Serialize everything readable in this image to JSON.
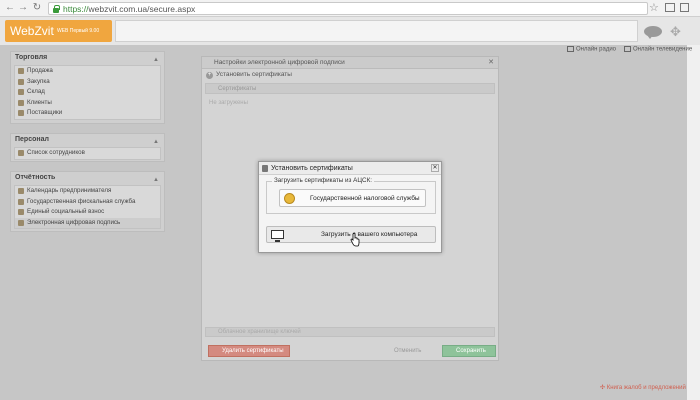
{
  "browser": {
    "url_protocol": "https://",
    "url_host": "webzvit.com.ua",
    "url_path": "/secure.aspx"
  },
  "header": {
    "logo": "WebZvit",
    "logo_subtitle": "WEB Первый 9.00"
  },
  "top_links": {
    "radio": "Онлайн радио",
    "tv": "Онлайн телевидение"
  },
  "sidebar": {
    "sections": [
      {
        "title": "Торговля",
        "items": [
          "Продажа",
          "Закупка",
          "Склад",
          "Клиенты",
          "Поставщики"
        ]
      },
      {
        "title": "Персонал",
        "items": [
          "Список сотрудников"
        ]
      },
      {
        "title": "Отчётность",
        "items": [
          "Календарь предпринимателя",
          "Государственная фискальная служба",
          "Единый социальный взнос",
          "Электронная цифровая подпись"
        ]
      }
    ]
  },
  "settings_dialog": {
    "title": "Настройки электронной цифровой подписи",
    "install_label": "Установить сертификаты",
    "certificates_tab": "Сертификаты",
    "empty_text": "Не загружены",
    "storage_tab": "Облачное хранилище ключей",
    "delete_button": "Удалить сертификаты",
    "cancel_button": "Отменить",
    "save_button": "Сохранить"
  },
  "modal": {
    "title": "Установить сертификаты",
    "legend": "Загрузить сертификаты из АЦСК:",
    "tax_button": "Государственной налоговой службы",
    "upload_button": "Загрузить с вашего компьютера"
  },
  "footer_link": "Книга жалоб и предложений",
  "colors": {
    "logo": "#f0a63f",
    "delete": "#d48a80",
    "save": "#8ec39a"
  }
}
